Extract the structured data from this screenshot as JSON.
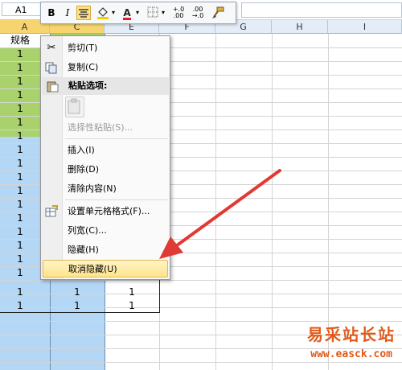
{
  "formula_bar": {
    "name_box": "A1"
  },
  "mini_toolbar": {
    "bold": "B",
    "italic": "I",
    "font_color_letter": "A",
    "increase_decimal": "+.0\n.00",
    "decrease_decimal": ".00\n→.0"
  },
  "columns": [
    "A",
    "C",
    "E",
    "F",
    "G",
    "H",
    "I"
  ],
  "sheet": {
    "a1": "规格",
    "c_rows": [
      "1",
      "1",
      "1",
      "1",
      "1",
      "1",
      "1",
      "1",
      "1",
      "1",
      "1",
      "1",
      "1",
      "1",
      "1",
      "1",
      "1",
      "1",
      "1",
      "1"
    ],
    "e_rows_tail": [
      "1",
      "1"
    ],
    "c_tail": [
      "1",
      "1"
    ],
    "a_tail": [
      "1",
      "1"
    ]
  },
  "context_menu": {
    "items": [
      {
        "label": "剪切(T)"
      },
      {
        "label": "复制(C)"
      },
      {
        "label": "粘贴选项:"
      },
      {
        "label": "选择性粘贴(S)..."
      },
      {
        "label": "插入(I)"
      },
      {
        "label": "删除(D)"
      },
      {
        "label": "清除内容(N)"
      },
      {
        "label": "设置单元格格式(F)..."
      },
      {
        "label": "列宽(C)..."
      },
      {
        "label": "隐藏(H)"
      },
      {
        "label": "取消隐藏(U)"
      }
    ]
  },
  "watermark": {
    "cn": "易采站长站",
    "url": "www.easck.com"
  },
  "colors": {
    "green_fill": "#a9d26c",
    "blue_fill": "#b4d7f5",
    "arrow": "#e03a34",
    "highlight": "#ffe48c"
  }
}
